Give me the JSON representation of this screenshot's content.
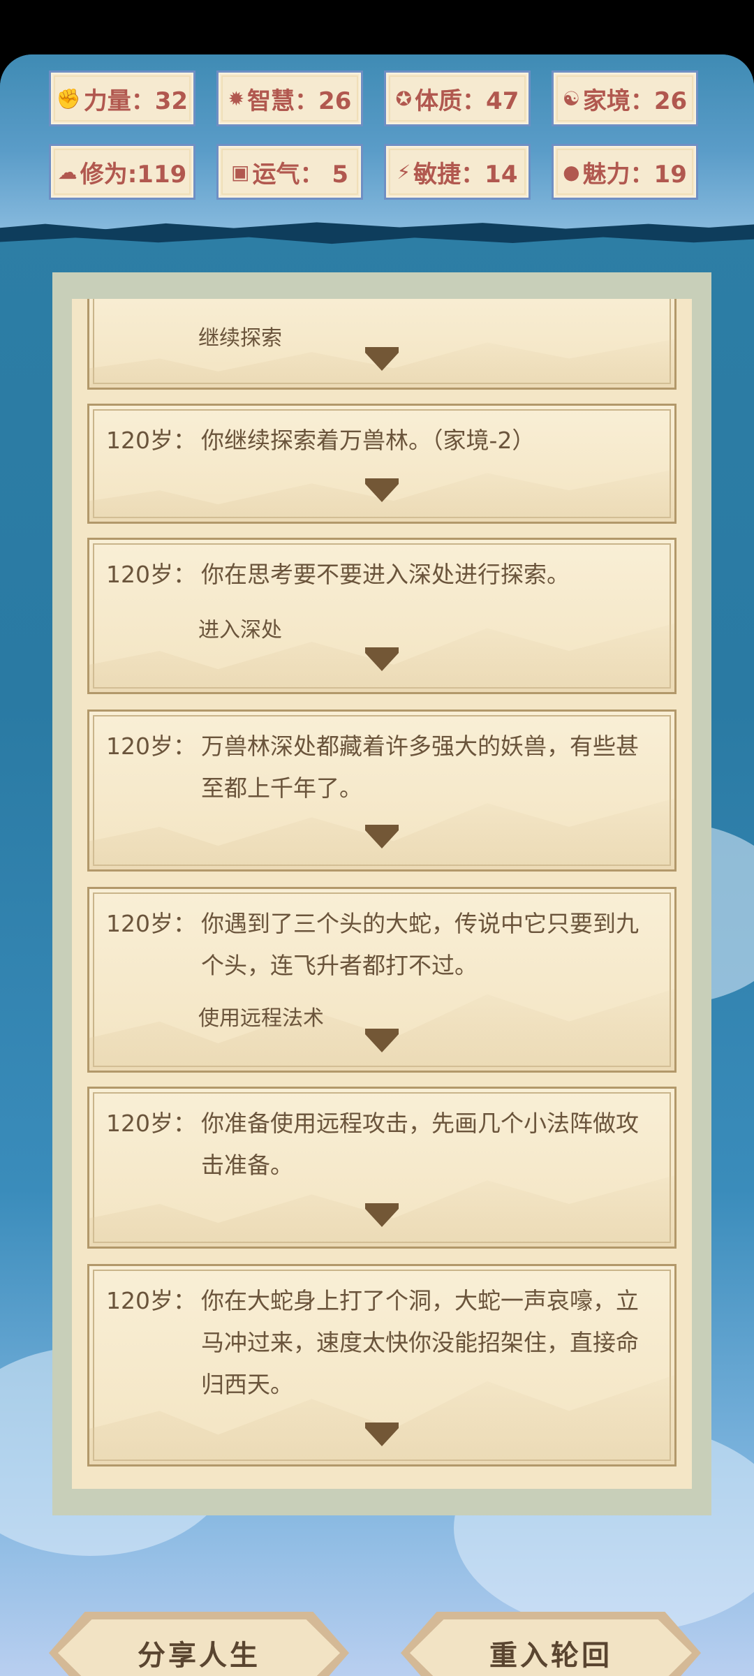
{
  "stats": [
    {
      "icon": "fist-icon",
      "glyph": "✊",
      "label": "力量：32"
    },
    {
      "icon": "lightbulb-icon",
      "glyph": "✹",
      "label": "智慧：26"
    },
    {
      "icon": "body-icon",
      "glyph": "✪",
      "label": "体质：47"
    },
    {
      "icon": "house-icon",
      "glyph": "☯",
      "label": "家境：26"
    },
    {
      "icon": "cloud-icon",
      "glyph": "☁",
      "label": "修为:119"
    },
    {
      "icon": "luck-icon",
      "glyph": "▣",
      "label": "运气： 5"
    },
    {
      "icon": "lightning-icon",
      "glyph": "⚡",
      "label": "敏捷：14"
    },
    {
      "icon": "charm-icon",
      "glyph": "●",
      "label": "魅力：19"
    }
  ],
  "log": {
    "partial_top": {
      "choice": "继续探索"
    },
    "entries": [
      {
        "age": "120岁：",
        "text": "你继续探索着万兽林。（家境-2）",
        "choice": ""
      },
      {
        "age": "120岁：",
        "text": "你在思考要不要进入深处进行探索。",
        "choice": "进入深处"
      },
      {
        "age": "120岁：",
        "text": "万兽林深处都藏着许多强大的妖兽，有些甚至都上千年了。",
        "choice": ""
      },
      {
        "age": "120岁：",
        "text": "你遇到了三个头的大蛇，传说中它只要到九个头，连飞升者都打不过。",
        "choice": "使用远程法术"
      },
      {
        "age": "120岁：",
        "text": "你准备使用远程攻击，先画几个小法阵做攻击准备。",
        "choice": ""
      },
      {
        "age": "120岁：",
        "text": "你在大蛇身上打了个洞，大蛇一声哀嚎，立马冲过来，速度太快你没能招架住，直接命归西天。",
        "choice": ""
      }
    ]
  },
  "buttons": {
    "share": "分享人生",
    "restart": "重入轮回"
  }
}
